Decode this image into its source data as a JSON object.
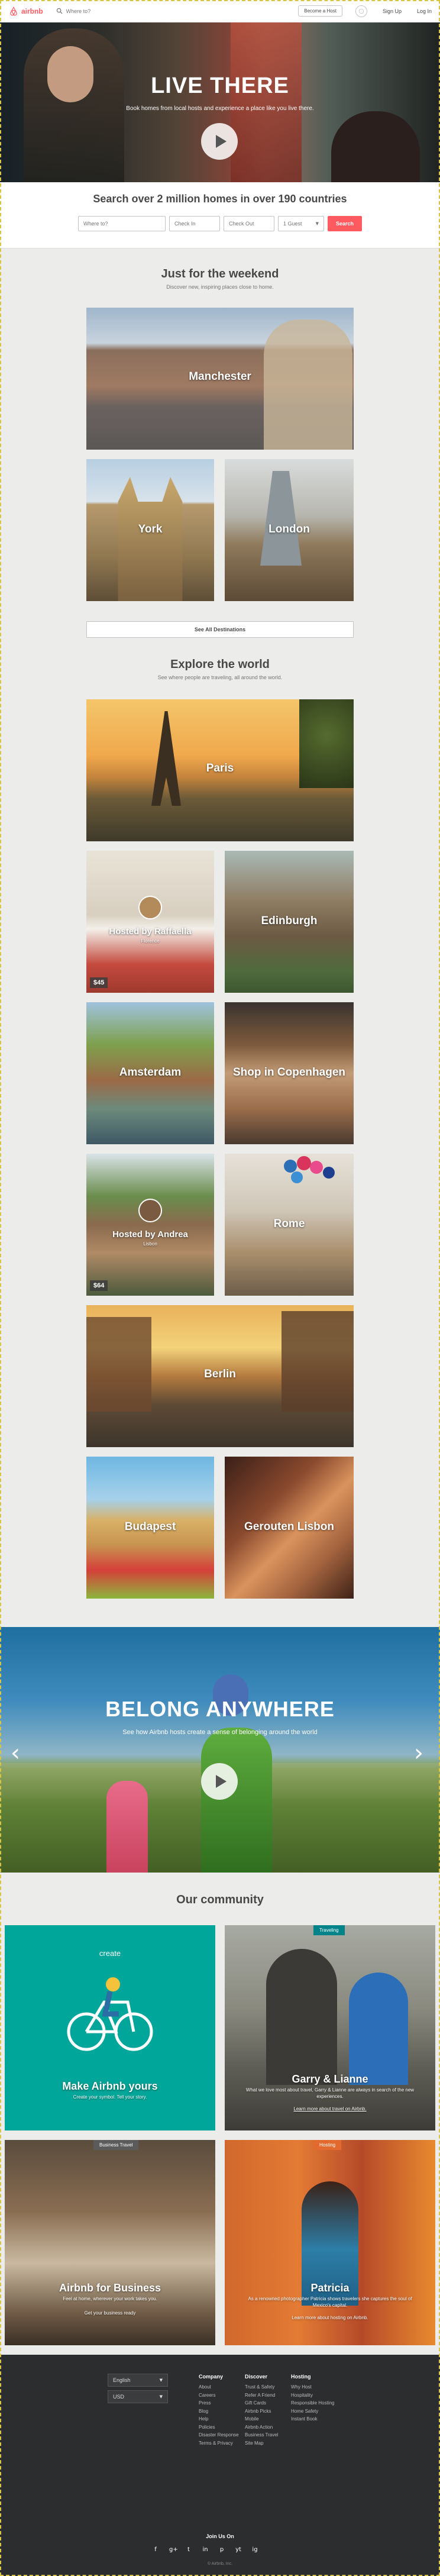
{
  "header": {
    "brand": "airbnb",
    "search_placeholder": "Where to?",
    "host_label": "Become a Host",
    "signup_label": "Sign Up",
    "login_label": "Log In"
  },
  "hero": {
    "title": "LIVE THERE",
    "subtitle": "Book homes from local hosts and experience a place like you live there."
  },
  "search": {
    "title": "Search over 2 million homes in over 190 countries",
    "where_placeholder": "Where to?",
    "checkin_placeholder": "Check In",
    "checkout_placeholder": "Check Out",
    "guests_value": "1 Guest",
    "button_label": "Search"
  },
  "weekend": {
    "title": "Just for the weekend",
    "subtitle": "Discover new, inspiring places close to home.",
    "tiles": [
      {
        "label": "Manchester"
      },
      {
        "label": "York"
      },
      {
        "label": "London"
      }
    ],
    "see_all_label": "See All Destinations"
  },
  "explore": {
    "title": "Explore the world",
    "subtitle": "See where people are traveling, all around the world.",
    "tiles": [
      {
        "label": "Paris"
      },
      {
        "label": "Hosted by Raffaella",
        "sub": "Florence",
        "price": "$45"
      },
      {
        "label": "Edinburgh"
      },
      {
        "label": "Amsterdam"
      },
      {
        "label": "Shop in Copenhagen"
      },
      {
        "label": "Hosted by Andrea",
        "sub": "Lisbon",
        "price": "$64"
      },
      {
        "label": "Rome"
      },
      {
        "label": "Berlin"
      },
      {
        "label": "Budapest"
      },
      {
        "label": "Gerouten Lisbon"
      }
    ]
  },
  "belong": {
    "title": "BELONG ANYWHERE",
    "subtitle": "See how Airbnb hosts create a sense of belonging around the world"
  },
  "community": {
    "title": "Our community",
    "cards": [
      {
        "badge": "",
        "logo": "create",
        "title": "Make Airbnb yours",
        "text": "Create your symbol. Tell your story."
      },
      {
        "badge": "Traveling",
        "title": "Garry & Lianne",
        "text": "What we love most about travel, Garry & Lianne are always in search of the new experiences.",
        "link": "Learn more about travel on Airbnb."
      },
      {
        "badge": "Business Travel",
        "title": "Airbnb for Business",
        "text": "Feel at home, wherever your work takes you.",
        "link": "Get your business ready"
      },
      {
        "badge": "Hosting",
        "title": "Patricia",
        "text": "As a renowned photographer Patricia shows travelers she captures the soul of Mexico's capital.",
        "link": "Learn more about hosting on Airbnb."
      }
    ]
  },
  "footer": {
    "language": "English",
    "currency": "USD",
    "columns": [
      {
        "head": "Company",
        "links": [
          "About",
          "Careers",
          "Press",
          "Blog",
          "Help",
          "Policies",
          "Disaster Response",
          "Terms & Privacy"
        ]
      },
      {
        "head": "Discover",
        "links": [
          "Trust & Safety",
          "Refer A Friend",
          "Gift Cards",
          "Airbnb Picks",
          "Mobile",
          "Airbnb Action",
          "Business Travel",
          "Site Map"
        ]
      },
      {
        "head": "Hosting",
        "links": [
          "Why Host",
          "Hospitality",
          "Responsible Hosting",
          "Home Safety",
          "Instant Book"
        ]
      }
    ],
    "join_label": "Join Us On",
    "social_icons": [
      "f",
      "g+",
      "t",
      "in",
      "p",
      "yt",
      "ig"
    ],
    "copyright": "© Airbnb, Inc."
  },
  "colors": {
    "brand": "#ff5a5f",
    "create_card": "#00a699",
    "travel_badge": "#008489",
    "business_badge": "#5b5b5b",
    "hosting_badge": "#e36a2e"
  }
}
